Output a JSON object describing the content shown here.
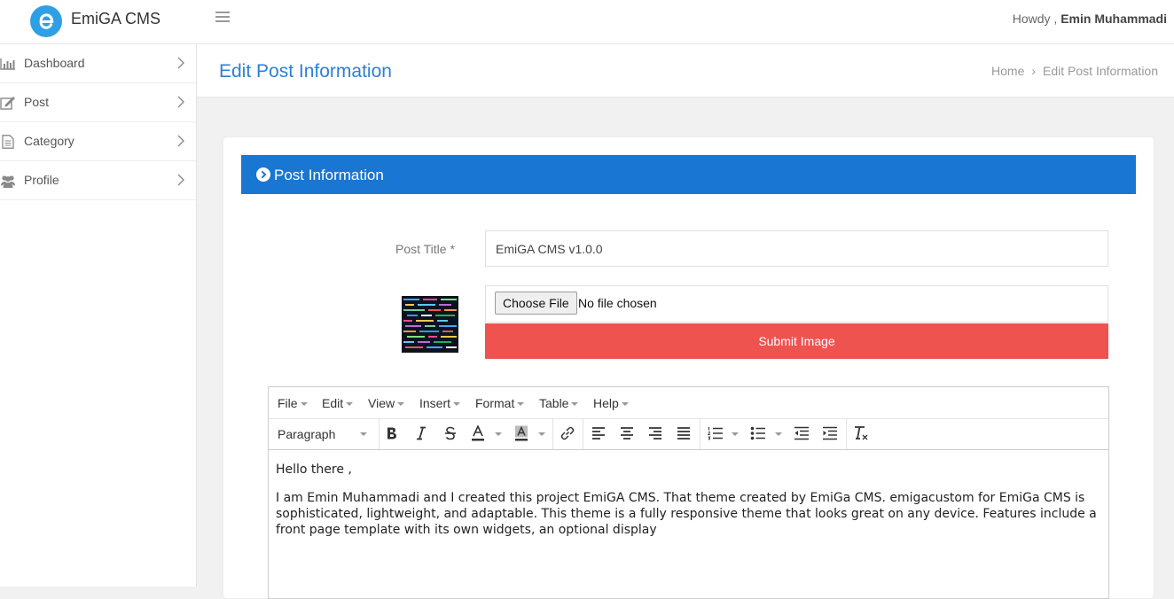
{
  "brand": {
    "name": "EmiGA CMS",
    "accent": "#2f9fe5"
  },
  "header": {
    "howdy_prefix": "Howdy ,",
    "user_name": "Emin Muhammadi"
  },
  "sidebar": {
    "items": [
      {
        "label": "Dashboard",
        "icon": "bar-chart-icon"
      },
      {
        "label": "Post",
        "icon": "edit-icon"
      },
      {
        "label": "Category",
        "icon": "document-icon"
      },
      {
        "label": "Profile",
        "icon": "users-icon"
      }
    ]
  },
  "page": {
    "title": "Edit Post Information",
    "breadcrumb": [
      "Home",
      "Edit Post Information"
    ]
  },
  "card": {
    "header": "Post Information",
    "header_color": "#1976d2",
    "post_title_label": "Post Title *",
    "post_title_value": "EmiGA CMS v1.0.0",
    "choose_file_label": "Choose File",
    "no_file_text": "No file chosen",
    "submit_image_label": "Submit Image",
    "submit_color": "#ef5350"
  },
  "editor": {
    "menu": [
      "File",
      "Edit",
      "View",
      "Insert",
      "Format",
      "Table",
      "Help"
    ],
    "block_format": "Paragraph",
    "content": [
      "Hello there ,",
      "I am Emin Muhammadi and I created this project EmiGA CMS. That theme created by EmiGa CMS. emigacustom for EmiGa CMS is sophisticated, lightweight, and adaptable. This theme is a fully responsive theme that looks great on any device. Features include a front page template with its own widgets, an optional display"
    ]
  }
}
